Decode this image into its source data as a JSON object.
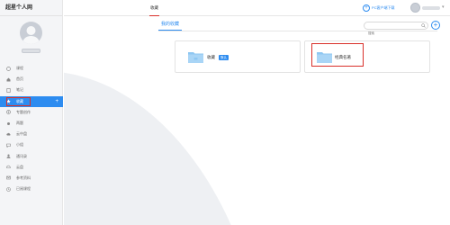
{
  "app": {
    "brand": "超星个人网"
  },
  "user": {
    "name_placeholder": "hidden"
  },
  "sidebar": {
    "items": [
      {
        "label": "课程",
        "icon": "course-icon",
        "active": false
      },
      {
        "label": "首页",
        "icon": "home-icon",
        "active": false
      },
      {
        "label": "笔记",
        "icon": "note-icon",
        "active": false
      },
      {
        "label": "收藏",
        "icon": "star-icon",
        "active": true
      },
      {
        "label": "专题创作",
        "icon": "topic-icon",
        "active": false
      },
      {
        "label": "两题",
        "icon": "dot-icon",
        "active": false
      },
      {
        "label": "云中盘",
        "icon": "cloud-icon",
        "active": false
      },
      {
        "label": "小组",
        "icon": "group-icon",
        "active": false
      },
      {
        "label": "通讯录",
        "icon": "contacts-icon",
        "active": false
      },
      {
        "label": "云盘",
        "icon": "pan-icon",
        "active": false
      },
      {
        "label": "参考资料",
        "icon": "reference-icon",
        "active": false
      },
      {
        "label": "已阅课程",
        "icon": "history-icon",
        "active": false
      }
    ],
    "add_symbol": "+"
  },
  "topbar": {
    "tab_label": "收藏",
    "download_label": "PC客户端下载",
    "download_icon": "+"
  },
  "main": {
    "subtab_label": "我的收藏",
    "search_placeholder": "搜索",
    "add_symbol": "+",
    "folders": [
      {
        "label": "收藏",
        "badge": "默认"
      },
      {
        "label": "经典名著",
        "badge": ""
      }
    ]
  },
  "colors": {
    "accent": "#2d8cf0",
    "highlight": "#d9302a",
    "folder": "#8ec7f2"
  }
}
